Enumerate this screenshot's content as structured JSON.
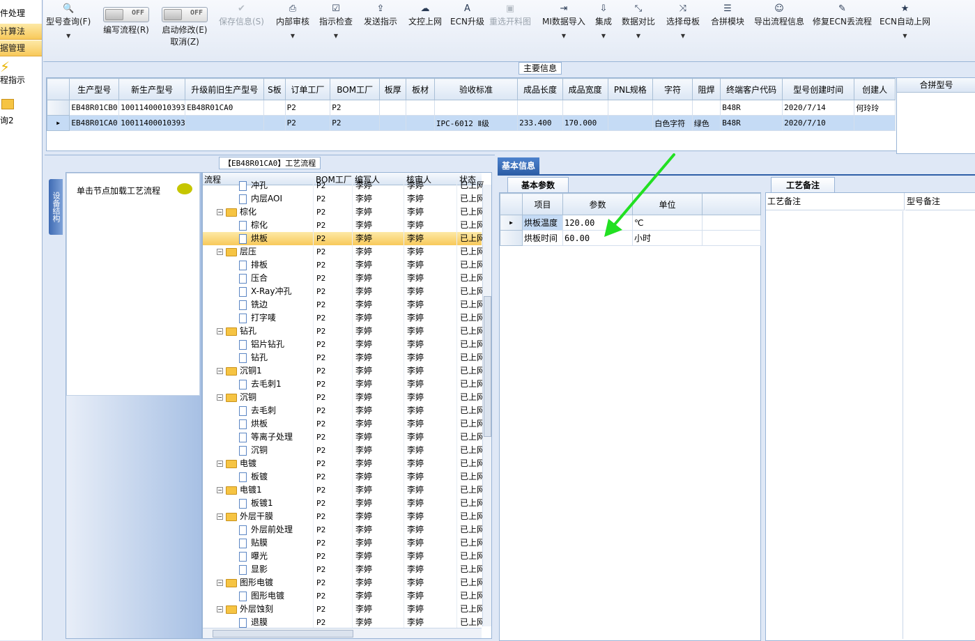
{
  "left_nav": {
    "items": [
      "件处理",
      "计算法",
      "据管理"
    ],
    "icon_items": [
      {
        "icon": "lightning-icon",
        "label": "程指示"
      },
      {
        "icon": "folder-open-icon",
        "label": "询2"
      }
    ]
  },
  "toolbar": {
    "buttons": [
      {
        "label": "型号查询(F)",
        "icon": "search-icon",
        "glyph": "🔍",
        "dropdown": true,
        "disabled": false
      },
      {
        "label": "编写流程(R)",
        "icon": "toggle-icon",
        "toggle_text": "OFF",
        "disabled": false
      },
      {
        "label": "启动修改(E)",
        "label2": "取消(Z)",
        "icon": "toggle-icon",
        "toggle_text": "OFF",
        "disabled": false
      },
      {
        "label": "保存信息(S)",
        "icon": "check-icon",
        "glyph": "✔",
        "disabled": true
      },
      {
        "label": "内部审核",
        "icon": "print-icon",
        "glyph": "⎙",
        "dropdown": true,
        "disabled": false
      },
      {
        "label": "指示检查",
        "icon": "checkbox-icon",
        "glyph": "☑",
        "dropdown": true,
        "disabled": false
      },
      {
        "label": "发送指示",
        "icon": "upload-icon",
        "glyph": "⇪",
        "disabled": false
      },
      {
        "label": "文控上网",
        "icon": "cloud-upload-icon",
        "glyph": "☁",
        "disabled": false
      },
      {
        "label": "ECN升级",
        "icon": "font-icon",
        "glyph": "A",
        "disabled": false
      },
      {
        "label": "重选开料图",
        "icon": "image-icon",
        "glyph": "▣",
        "disabled": true
      },
      {
        "label": "MI数据导入",
        "icon": "sign-in-icon",
        "glyph": "⇥",
        "dropdown": true,
        "disabled": false
      },
      {
        "label": "集成",
        "icon": "download-icon",
        "glyph": "⇩",
        "dropdown": true,
        "disabled": false
      },
      {
        "label": "数据对比",
        "icon": "compress-icon",
        "glyph": "⤡",
        "dropdown": true,
        "disabled": false
      },
      {
        "label": "选择母板",
        "icon": "random-icon",
        "glyph": "⤨",
        "dropdown": true,
        "disabled": false
      },
      {
        "label": "合拼模块",
        "icon": "list-icon",
        "glyph": "☰",
        "disabled": false
      },
      {
        "label": "导出流程信息",
        "icon": "smile-icon",
        "glyph": "☺",
        "disabled": false
      },
      {
        "label": "修复ECN丢流程",
        "icon": "wrench-icon",
        "glyph": "✎",
        "disabled": false
      },
      {
        "label": "ECN自动上网",
        "icon": "star-icon",
        "glyph": "★",
        "dropdown": true,
        "disabled": false
      }
    ]
  },
  "main_info": {
    "tab_label": "主要信息",
    "columns": [
      "生产型号",
      "新生产型号",
      "升级前旧生产型号",
      "S板",
      "订单工厂",
      "BOM工厂",
      "板厚",
      "板材",
      "验收标准",
      "成品长度",
      "成品宽度",
      "PNL规格",
      "字符",
      "阻焊",
      "终端客户代码",
      "型号创建时间",
      "创建人"
    ],
    "rows": [
      [
        "EB48R01CB0",
        "10011400010393",
        "EB48R01CA0",
        "",
        "P2",
        "P2",
        "",
        "",
        "",
        "",
        "",
        "",
        "",
        "",
        "B48R",
        "2020/7/14",
        "何玲玲"
      ],
      [
        "EB48R01CA0",
        "10011400010393",
        "",
        "",
        "P2",
        "P2",
        "",
        "",
        "IPC-6012 Ⅱ级",
        "233.400",
        "170.000",
        "",
        "白色字符",
        "绿色",
        "B48R",
        "2020/7/10",
        ""
      ]
    ],
    "selected_row": 1,
    "merge_header": "合拼型号"
  },
  "flow_panel": {
    "tab_label": "【EB48R01CA0】工艺流程",
    "side_tab": "设备结构",
    "node_hint": "单击节点加载工艺流程",
    "columns": [
      "流程",
      "BOM工厂",
      "编写人",
      "核审人",
      "状态"
    ],
    "rows": [
      {
        "name": "冲孔",
        "level": 1,
        "type": "doc",
        "factory": "P2",
        "writer": "李婷",
        "reviewer": "李婷",
        "status": "已上网"
      },
      {
        "name": "内层AOI",
        "level": 1,
        "type": "doc",
        "factory": "P2",
        "writer": "李婷",
        "reviewer": "李婷",
        "status": "已上网"
      },
      {
        "name": "棕化",
        "level": 0,
        "type": "folder",
        "factory": "P2",
        "writer": "李婷",
        "reviewer": "李婷",
        "status": "已上网"
      },
      {
        "name": "棕化",
        "level": 1,
        "type": "doc",
        "factory": "P2",
        "writer": "李婷",
        "reviewer": "李婷",
        "status": "已上网"
      },
      {
        "name": "烘板",
        "level": 1,
        "type": "doc",
        "factory": "P2",
        "writer": "李婷",
        "reviewer": "李婷",
        "status": "已上网",
        "selected": true
      },
      {
        "name": "层压",
        "level": 0,
        "type": "folder",
        "factory": "P2",
        "writer": "李婷",
        "reviewer": "李婷",
        "status": "已上网"
      },
      {
        "name": "排板",
        "level": 1,
        "type": "doc",
        "factory": "P2",
        "writer": "李婷",
        "reviewer": "李婷",
        "status": "已上网"
      },
      {
        "name": "压合",
        "level": 1,
        "type": "doc",
        "factory": "P2",
        "writer": "李婷",
        "reviewer": "李婷",
        "status": "已上网"
      },
      {
        "name": "X-Ray冲孔",
        "level": 1,
        "type": "doc",
        "factory": "P2",
        "writer": "李婷",
        "reviewer": "李婷",
        "status": "已上网"
      },
      {
        "name": "铣边",
        "level": 1,
        "type": "doc",
        "factory": "P2",
        "writer": "李婷",
        "reviewer": "李婷",
        "status": "已上网"
      },
      {
        "name": "打字唛",
        "level": 1,
        "type": "doc",
        "factory": "P2",
        "writer": "李婷",
        "reviewer": "李婷",
        "status": "已上网"
      },
      {
        "name": "钻孔",
        "level": 0,
        "type": "folder",
        "factory": "P2",
        "writer": "李婷",
        "reviewer": "李婷",
        "status": "已上网"
      },
      {
        "name": "铝片钻孔",
        "level": 1,
        "type": "doc",
        "factory": "P2",
        "writer": "李婷",
        "reviewer": "李婷",
        "status": "已上网"
      },
      {
        "name": "钻孔",
        "level": 1,
        "type": "doc",
        "factory": "P2",
        "writer": "李婷",
        "reviewer": "李婷",
        "status": "已上网"
      },
      {
        "name": "沉铜1",
        "level": 0,
        "type": "folder",
        "factory": "P2",
        "writer": "李婷",
        "reviewer": "李婷",
        "status": "已上网"
      },
      {
        "name": "去毛刺1",
        "level": 1,
        "type": "doc",
        "factory": "P2",
        "writer": "李婷",
        "reviewer": "李婷",
        "status": "已上网"
      },
      {
        "name": "沉铜",
        "level": 0,
        "type": "folder",
        "factory": "P2",
        "writer": "李婷",
        "reviewer": "李婷",
        "status": "已上网"
      },
      {
        "name": "去毛刺",
        "level": 1,
        "type": "doc",
        "factory": "P2",
        "writer": "李婷",
        "reviewer": "李婷",
        "status": "已上网"
      },
      {
        "name": "烘板",
        "level": 1,
        "type": "doc",
        "factory": "P2",
        "writer": "李婷",
        "reviewer": "李婷",
        "status": "已上网"
      },
      {
        "name": "等离子处理",
        "level": 1,
        "type": "doc",
        "factory": "P2",
        "writer": "李婷",
        "reviewer": "李婷",
        "status": "已上网"
      },
      {
        "name": "沉铜",
        "level": 1,
        "type": "doc",
        "factory": "P2",
        "writer": "李婷",
        "reviewer": "李婷",
        "status": "已上网"
      },
      {
        "name": "电镀",
        "level": 0,
        "type": "folder",
        "factory": "P2",
        "writer": "李婷",
        "reviewer": "李婷",
        "status": "已上网"
      },
      {
        "name": "板镀",
        "level": 1,
        "type": "doc",
        "factory": "P2",
        "writer": "李婷",
        "reviewer": "李婷",
        "status": "已上网"
      },
      {
        "name": "电镀1",
        "level": 0,
        "type": "folder",
        "factory": "P2",
        "writer": "李婷",
        "reviewer": "李婷",
        "status": "已上网"
      },
      {
        "name": "板镀1",
        "level": 1,
        "type": "doc",
        "factory": "P2",
        "writer": "李婷",
        "reviewer": "李婷",
        "status": "已上网"
      },
      {
        "name": "外层干膜",
        "level": 0,
        "type": "folder",
        "factory": "P2",
        "writer": "李婷",
        "reviewer": "李婷",
        "status": "已上网"
      },
      {
        "name": "外层前处理",
        "level": 1,
        "type": "doc",
        "factory": "P2",
        "writer": "李婷",
        "reviewer": "李婷",
        "status": "已上网"
      },
      {
        "name": "贴膜",
        "level": 1,
        "type": "doc",
        "factory": "P2",
        "writer": "李婷",
        "reviewer": "李婷",
        "status": "已上网"
      },
      {
        "name": "曝光",
        "level": 1,
        "type": "doc",
        "factory": "P2",
        "writer": "李婷",
        "reviewer": "李婷",
        "status": "已上网"
      },
      {
        "name": "显影",
        "level": 1,
        "type": "doc",
        "factory": "P2",
        "writer": "李婷",
        "reviewer": "李婷",
        "status": "已上网"
      },
      {
        "name": "图形电镀",
        "level": 0,
        "type": "folder",
        "factory": "P2",
        "writer": "李婷",
        "reviewer": "李婷",
        "status": "已上网"
      },
      {
        "name": "图形电镀",
        "level": 1,
        "type": "doc",
        "factory": "P2",
        "writer": "李婷",
        "reviewer": "李婷",
        "status": "已上网"
      },
      {
        "name": "外层蚀刻",
        "level": 0,
        "type": "folder",
        "factory": "P2",
        "writer": "李婷",
        "reviewer": "李婷",
        "status": "已上网"
      },
      {
        "name": "退膜",
        "level": 1,
        "type": "doc",
        "factory": "P2",
        "writer": "李婷",
        "reviewer": "李婷",
        "status": "已上网"
      }
    ]
  },
  "basic_info": {
    "tab_label": "基本信息",
    "params_tab": "基本参数",
    "columns": [
      "项目",
      "参数",
      "单位"
    ],
    "rows": [
      [
        "烘板温度",
        "120.00",
        "℃"
      ],
      [
        "烘板时间",
        "60.00",
        "小时"
      ]
    ],
    "remark_tab": "工艺备注",
    "remark_columns": [
      "工艺备注",
      "型号备注"
    ],
    "annotation_arrow_color": "#22e022"
  },
  "colors": {
    "selection_yellow": "#f8c95a",
    "selection_blue": "#c5dbf5",
    "accent_blue": "#2e5fa7"
  }
}
